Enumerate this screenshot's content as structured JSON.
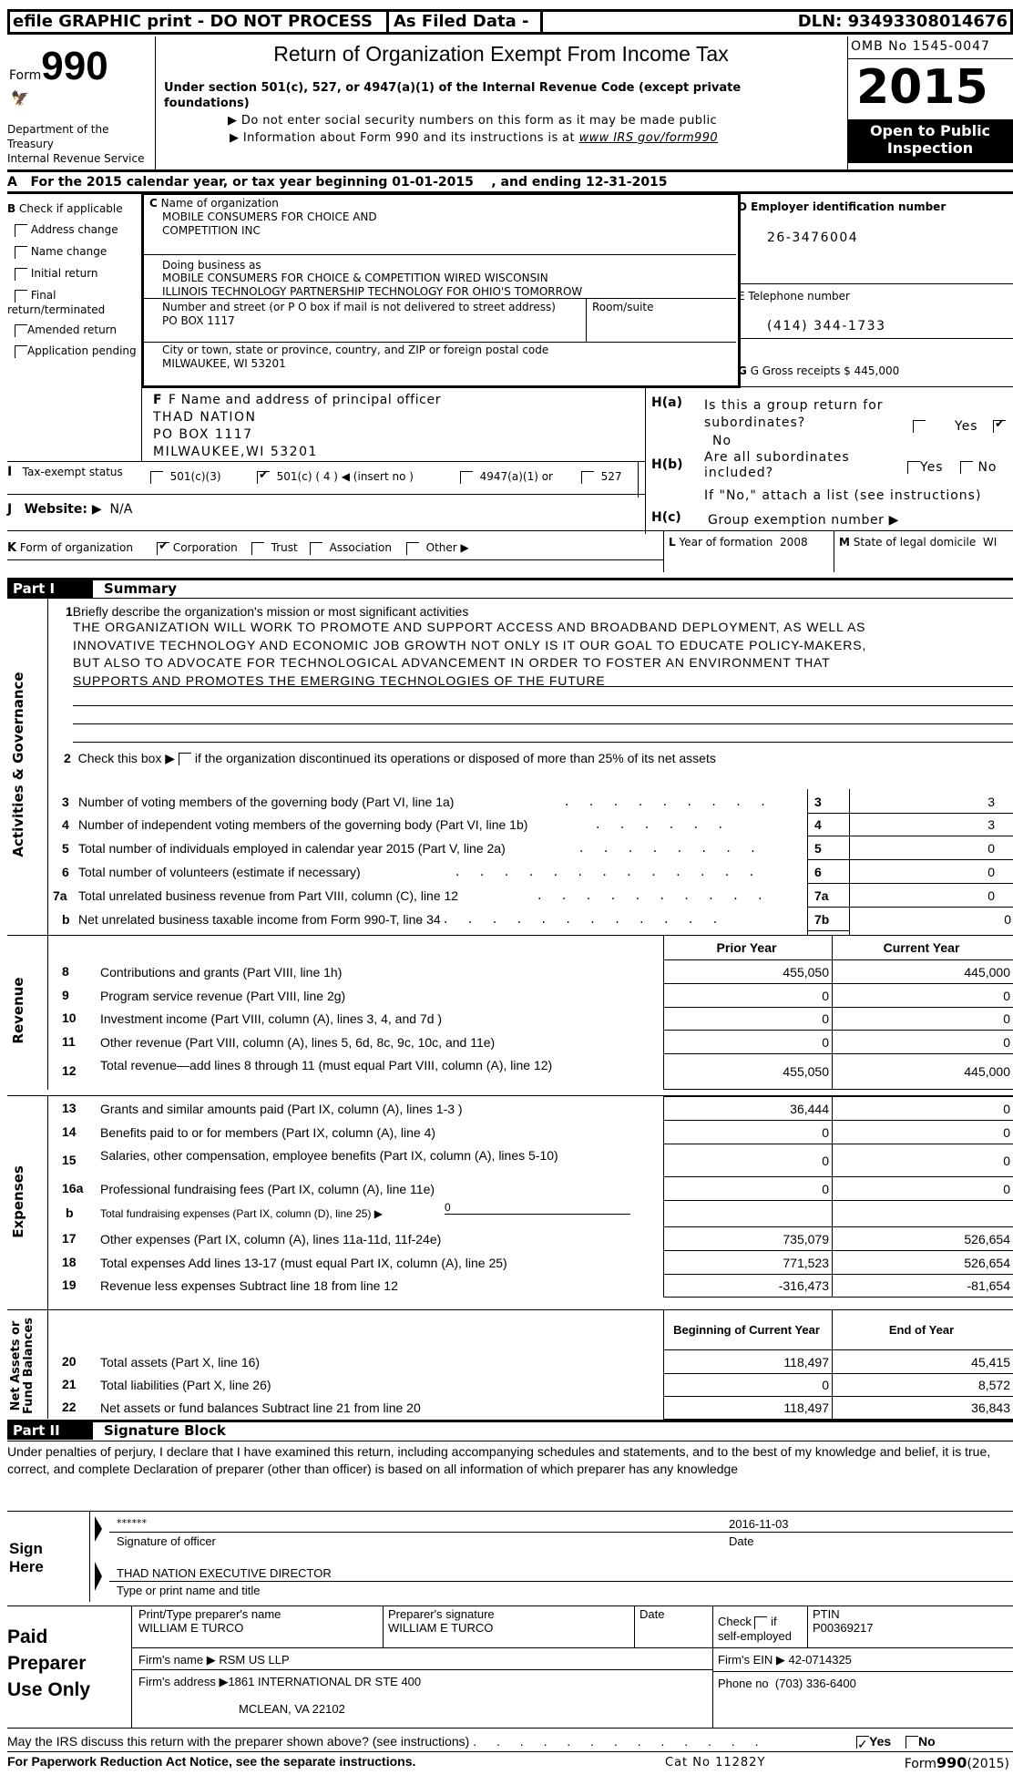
{
  "topbar": {
    "efile": "efile GRAPHIC print - DO NOT PROCESS",
    "filed": "As Filed Data -",
    "dln": "DLN: 93493308014676"
  },
  "header": {
    "form_word": "Form",
    "form_number": "990",
    "dept1": "Department of the Treasury",
    "dept2": "Internal Revenue Service",
    "title": "Return of Organization Exempt From Income Tax",
    "subtitle": "Under section 501(c), 527, or 4947(a)(1) of the Internal Revenue Code (except private foundations)",
    "note1": "▶ Do not enter social security numbers on this form as it may be made public",
    "note2_prefix": "▶ Information about Form 990 and its instructions is at ",
    "note2_link": "www IRS gov/form990",
    "omb": "OMB No 1545-0047",
    "year": "2015",
    "open_public": "Open to Public Inspection"
  },
  "lineA": {
    "text": "A   For the 2015 calendar year, or tax year beginning 01-01-2015    , and ending 12-31-2015"
  },
  "sectionB": {
    "title_letter": "B",
    "title": "Check if applicable",
    "items": [
      {
        "label": "Address change",
        "checked": false
      },
      {
        "label": "Name change",
        "checked": false
      },
      {
        "label": "Initial return",
        "checked": false
      },
      {
        "label": "Final return/terminated",
        "checked": false
      },
      {
        "label": "Amended return",
        "checked": false
      },
      {
        "label": "Application pending",
        "checked": false
      }
    ]
  },
  "sectionC": {
    "name_label": "Name of organization",
    "name_line1": "MOBILE CONSUMERS FOR CHOICE AND",
    "name_line2": "COMPETITION INC",
    "dba_label": "Doing business as",
    "dba_line1": "MOBILE CONSUMERS FOR CHOICE & COMPETITION WIRED WISCONSIN",
    "dba_line2": "ILLINOIS TECHNOLOGY PARTNERSHIP TECHNOLOGY FOR OHIO'S TOMORROW",
    "street_label": "Number and street (or P O  box if mail is not delivered to street address)",
    "street": "PO BOX 1117",
    "room_label": "Room/suite",
    "city_label": "City or town, state or province, country, and ZIP or foreign postal code",
    "city": "MILWAUKEE, WI  53201"
  },
  "sectionD": {
    "label": "D Employer identification number",
    "value": "26-3476004"
  },
  "sectionE": {
    "label": "E Telephone number",
    "value": "(414) 344-1733"
  },
  "sectionG": {
    "label": "G Gross receipts $ 445,000"
  },
  "sectionF": {
    "label": "F  Name and address of principal officer",
    "line1": "THAD NATION",
    "line2": "PO BOX 1117",
    "line3": "MILWAUKEE,WI  53201"
  },
  "sectionH": {
    "ha_label": "H(a)",
    "ha_q1": "Is this a group return for",
    "ha_q2": "subordinates?",
    "ha_yes": "Yes",
    "ha_no": "No",
    "hb_label": "H(b)",
    "hb_q1": "Are all subordinates",
    "hb_q2": "included?",
    "hb_yes": "Yes",
    "hb_no": "No",
    "hb_note": "If \"No,\" attach a list  (see instructions)",
    "hc_label": "H(c)",
    "hc_text": "Group exemption number ▶"
  },
  "sectionI": {
    "letter": "I",
    "label": "Tax-exempt status",
    "opt1": "501(c)(3)",
    "opt2": "501(c) ( 4 ) ◀ (insert no )",
    "opt3": "4947(a)(1) or",
    "opt4": "527"
  },
  "sectionJ": {
    "letter": "J",
    "label": "Website: ▶",
    "value": "N/A"
  },
  "sectionK": {
    "letter": "K",
    "label": "Form of organization",
    "opts": [
      "Corporation",
      "Trust",
      "Association",
      "Other ▶"
    ]
  },
  "sectionL": {
    "letter": "L",
    "label": "Year of formation",
    "value": "2008"
  },
  "sectionM": {
    "letter": "M",
    "label": "State of legal domicile",
    "value": "WI"
  },
  "part1": {
    "tag": "Part I",
    "title": "Summary",
    "side_gov": "Activities & Governance",
    "side_rev": "Revenue",
    "side_exp": "Expenses",
    "side_net1": "Net Assets or",
    "side_net2": "Fund Balances",
    "line1_num": "1",
    "line1_label": "Briefly describe the organization's mission or most significant activities",
    "mission": [
      "THE ORGANIZATION WILL WORK TO PROMOTE AND SUPPORT ACCESS AND BROADBAND DEPLOYMENT, AS WELL AS",
      "INNOVATIVE TECHNOLOGY AND ECONOMIC JOB GROWTH  NOT ONLY IS IT OUR GOAL TO EDUCATE POLICY-MAKERS,",
      "BUT ALSO TO ADVOCATE FOR TECHNOLOGICAL ADVANCEMENT IN ORDER TO FOSTER AN ENVIRONMENT THAT",
      "SUPPORTS AND PROMOTES THE EMERGING TECHNOLOGIES OF THE FUTURE"
    ],
    "line2_num": "2",
    "line2_pre": "Check this box ▶",
    "line2_post": "if the organization discontinued its operations or disposed of more than 25% of its net assets",
    "gov_lines": [
      {
        "num": "3",
        "label": "Number of voting members of the governing body (Part VI, line 1a)",
        "box": "3",
        "value": "3"
      },
      {
        "num": "4",
        "label": "Number of independent voting members of the governing body (Part VI, line 1b)",
        "box": "4",
        "value": "3"
      },
      {
        "num": "5",
        "label": "Total number of individuals employed in calendar year 2015 (Part V, line 2a)",
        "box": "5",
        "value": "0"
      },
      {
        "num": "6",
        "label": "Total number of volunteers (estimate if necessary)",
        "box": "6",
        "value": "0"
      },
      {
        "num": "7a",
        "label": "Total unrelated business revenue from Part VIII, column (C), line 12",
        "box": "7a",
        "value": "0"
      },
      {
        "num": "b",
        "label": "Net unrelated business taxable income from Form 990-T, line 34",
        "box": "7b",
        "value": "0"
      }
    ],
    "col_prior": "Prior Year",
    "col_current": "Current Year",
    "revenue": [
      {
        "num": "8",
        "label": "Contributions and grants (Part VIII, line 1h)",
        "prior": "455,050",
        "current": "445,000"
      },
      {
        "num": "9",
        "label": "Program service revenue (Part VIII, line 2g)",
        "prior": "0",
        "current": "0"
      },
      {
        "num": "10",
        "label": "Investment income (Part VIII, column (A), lines 3, 4, and 7d )",
        "prior": "0",
        "current": "0"
      },
      {
        "num": "11",
        "label": "Other revenue (Part VIII, column (A), lines 5, 6d, 8c, 9c, 10c, and 11e)",
        "prior": "0",
        "current": "0"
      },
      {
        "num": "12",
        "label": "Total revenue—add lines 8 through 11 (must equal Part VIII, column (A), line 12)",
        "prior": "455,050",
        "current": "445,000"
      }
    ],
    "expenses": [
      {
        "num": "13",
        "label": "Grants and similar amounts paid (Part IX, column (A), lines 1-3 )",
        "prior": "36,444",
        "current": "0"
      },
      {
        "num": "14",
        "label": "Benefits paid to or for members (Part IX, column (A), line 4)",
        "prior": "0",
        "current": "0"
      },
      {
        "num": "15",
        "label": "Salaries, other compensation, employee benefits (Part IX, column (A), lines 5-10)",
        "prior": "0",
        "current": "0"
      },
      {
        "num": "16a",
        "label": "Professional fundraising fees (Part IX, column (A), line 11e)",
        "prior": "0",
        "current": "0"
      },
      {
        "num": "b",
        "label": "Total fundraising expenses (Part IX, column (D), line 25) ▶",
        "inline_value": "0",
        "prior": "",
        "current": ""
      },
      {
        "num": "17",
        "label": "Other expenses (Part IX, column (A), lines 11a-11d, 11f-24e)",
        "prior": "735,079",
        "current": "526,654"
      },
      {
        "num": "18",
        "label": "Total expenses  Add lines 13-17 (must equal Part IX, column (A), line 25)",
        "prior": "771,523",
        "current": "526,654"
      },
      {
        "num": "19",
        "label": "Revenue less expenses  Subtract line 18 from line 12",
        "prior": "-316,473",
        "current": "-81,654"
      }
    ],
    "col_begin": "Beginning of Current Year",
    "col_end": "End of Year",
    "net": [
      {
        "num": "20",
        "label": "Total assets (Part X, line 16)",
        "begin": "118,497",
        "end": "45,415"
      },
      {
        "num": "21",
        "label": "Total liabilities (Part X, line 26)",
        "begin": "0",
        "end": "8,572"
      },
      {
        "num": "22",
        "label": "Net assets or fund balances  Subtract line 21 from line 20",
        "begin": "118,497",
        "end": "36,843"
      }
    ]
  },
  "part2": {
    "tag": "Part II",
    "title": "Signature Block",
    "declaration": "Under penalties of perjury, I declare that I have examined this return, including accompanying schedules and statements, and to the best of my knowledge and belief, it is true, correct, and complete  Declaration of preparer (other than officer) is based on all information of which preparer has any knowledge",
    "sign_here": "Sign Here",
    "signature": "******",
    "sig_date": "2016-11-03",
    "sig_label": "Signature of officer",
    "date_label": "Date",
    "name_title": "THAD NATION EXECUTIVE DIRECTOR",
    "name_title_label": "Type or print name and title"
  },
  "preparer": {
    "heading": "Paid Preparer Use Only",
    "name_label": "Print/Type preparer's name",
    "name": "WILLIAM E TURCO",
    "sig_label": "Preparer's signature",
    "sig": "WILLIAM E TURCO",
    "date_label": "Date",
    "check_label1": "Check",
    "check_label2": "if",
    "check_label3": "self-employed",
    "ptin_label": "PTIN",
    "ptin": "P00369217",
    "firm_name_label": "Firm's name   ▶",
    "firm_name": "RSM US LLP",
    "firm_ein_label": "Firm's EIN ▶",
    "firm_ein": "42-0714325",
    "firm_addr_label": "Firm's address ▶",
    "firm_addr1": "1861 INTERNATIONAL DR STE 400",
    "firm_addr2": "MCLEAN, VA  22102",
    "phone_label": "Phone no",
    "phone": "(703) 336-6400"
  },
  "footer": {
    "discuss": "May the IRS discuss this return with the preparer shown above? (see instructions)",
    "discuss_yes": "Yes",
    "discuss_no": "No",
    "paperwork": "For Paperwork Reduction Act Notice, see the separate instructions.",
    "cat": "Cat No 11282Y",
    "form_word": "Form",
    "form_num": "990",
    "form_year": "(2015)"
  }
}
